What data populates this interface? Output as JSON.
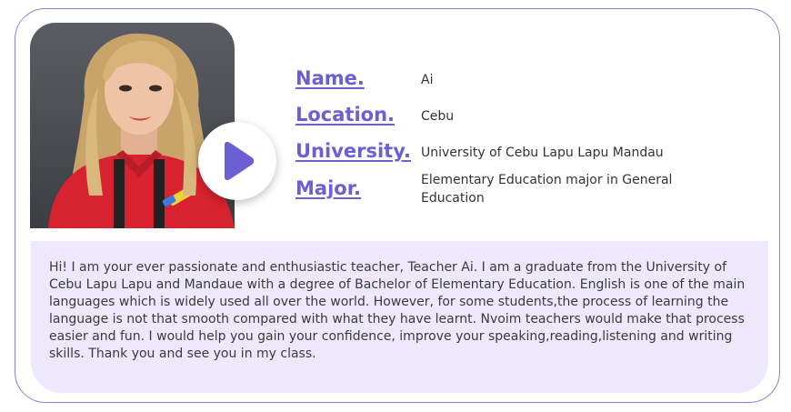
{
  "teacher": {
    "photo_icon": "teacher-portrait",
    "play_icon": "play-icon"
  },
  "profile": {
    "name_label": "Name.",
    "name_value": "Ai",
    "location_label": "Location.",
    "location_value": "Cebu",
    "university_label": "University.",
    "university_value": "University of Cebu Lapu Lapu Mandau",
    "major_label": "Major.",
    "major_value": "Elementary Education major in General Education"
  },
  "bio": {
    "text": "Hi! I am your ever passionate and enthusiastic teacher, Teacher Ai. I am a graduate from the University of Cebu Lapu Lapu and Mandaue with a degree of Bachelor of Elementary Education. English is one of the main languages which is widely used all over the world. However, for some students,the process of learning the language is not that smooth compared with what they have learnt. Nvoim teachers would make that process easier and fun. I would help you gain your confidence, improve your speaking,reading,listening and writing skills. Thank you and see you in my class."
  },
  "colors": {
    "accent": "#6b5fd3",
    "border": "#8b80d6",
    "bio_background": "#ede8fc"
  }
}
